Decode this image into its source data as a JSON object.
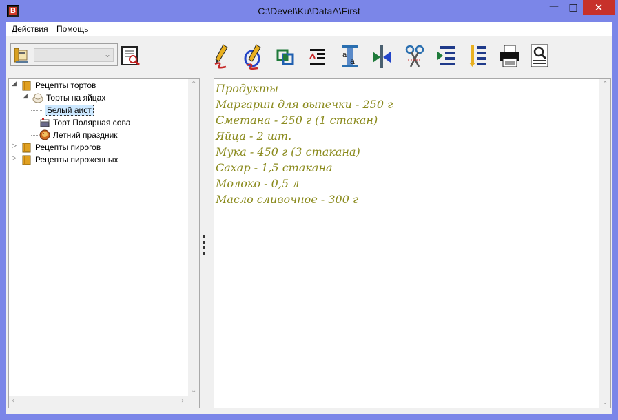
{
  "window": {
    "title": "C:\\Devel\\Ku\\DataA\\First",
    "app_icon_letter": "B",
    "controls": {
      "minimize": "—",
      "maximize": "□",
      "close": "✕"
    }
  },
  "menu": [
    {
      "label": "Действия"
    },
    {
      "label": "Помощь"
    }
  ],
  "toolbar": {
    "db_combo_value": "",
    "buttons": [
      {
        "name": "edit-pencil-icon"
      },
      {
        "name": "edit-link-icon"
      },
      {
        "name": "copy-squares-icon"
      },
      {
        "name": "text-format-icon"
      },
      {
        "name": "font-size-icon"
      },
      {
        "name": "merge-arrows-icon"
      },
      {
        "name": "scissors-icon"
      },
      {
        "name": "indent-list-icon"
      },
      {
        "name": "outline-list-icon"
      },
      {
        "name": "printer-icon"
      },
      {
        "name": "preview-icon"
      }
    ]
  },
  "tree": {
    "items": [
      {
        "label": "Рецепты тортов",
        "expanded": true
      },
      {
        "label": "Торты на яйцах",
        "expanded": true
      },
      {
        "label": "Белый аист",
        "selected": true
      },
      {
        "label": "Торт Полярная сова"
      },
      {
        "label": "Летний праздник"
      },
      {
        "label": "Рецепты пирогов",
        "expanded": false
      },
      {
        "label": "Рецепты пироженных",
        "expanded": false
      }
    ]
  },
  "content": {
    "lines": [
      "Продукты",
      "Маргарин для выпечки - 250 г",
      "Сметана - 250 г (1 стакан)",
      "Яйца - 2 шт.",
      "Мука - 450 г (3 стакана)",
      "Сахар - 1,5 стакана",
      "Молоко - 0,5 л",
      "Масло сливочное - 300 г"
    ],
    "text_color": "#8a8a1c"
  }
}
